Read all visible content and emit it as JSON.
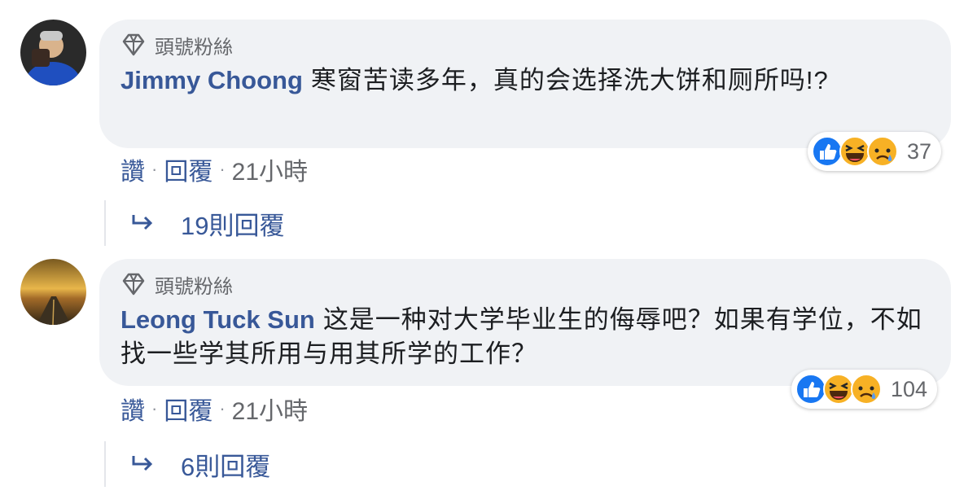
{
  "comments": [
    {
      "badge": "頭號粉絲",
      "author": "Jimmy Choong",
      "text": "寒窗苦读多年，真的会选择洗大饼和厕所吗!?",
      "reaction_count": "37",
      "reactions": [
        "like-icon",
        "haha-icon",
        "sad-icon"
      ],
      "like_label": "讚",
      "reply_label": "回覆",
      "time": "21小時",
      "replies_label": "19則回覆"
    },
    {
      "badge": "頭號粉絲",
      "author": "Leong Tuck Sun",
      "text": "这是一种对大学毕业生的侮辱吧？如果有学位，不如找一些学其所用与用其所学的工作？",
      "reaction_count": "104",
      "reactions": [
        "like-icon",
        "haha-icon",
        "sad-icon"
      ],
      "like_label": "讚",
      "reply_label": "回覆",
      "time": "21小時",
      "replies_label": "6則回覆"
    }
  ],
  "colors": {
    "name_blue": "#385898",
    "meta_gray": "#65676b",
    "bubble_bg": "#f0f2f5",
    "like_blue": "#1877f2",
    "emoji_yellow": "#f7b125"
  }
}
